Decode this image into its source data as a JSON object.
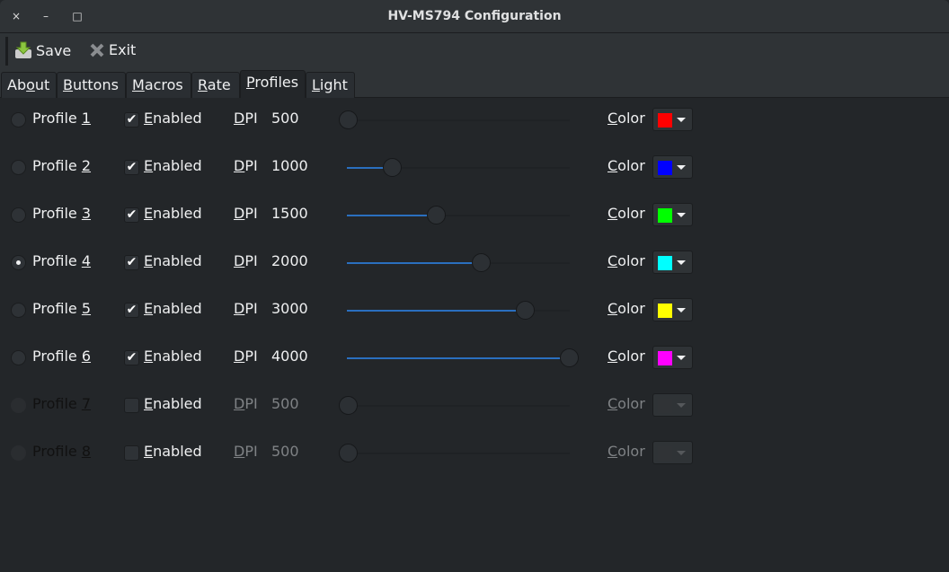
{
  "window": {
    "title": "HV-MS794 Configuration",
    "close": "×",
    "minimize": "–",
    "maximize": "□"
  },
  "toolbar": {
    "save": "Save",
    "exit": "Exit"
  },
  "tabs": [
    {
      "pre": "Ab",
      "u": "o",
      "post": "ut"
    },
    {
      "pre": "",
      "u": "B",
      "post": "uttons"
    },
    {
      "pre": "",
      "u": "M",
      "post": "acros"
    },
    {
      "pre": "",
      "u": "R",
      "post": "ate"
    },
    {
      "pre": "",
      "u": "P",
      "post": "rofiles"
    },
    {
      "pre": "",
      "u": "L",
      "post": "ight"
    }
  ],
  "active_tab": 4,
  "labels": {
    "profile": "Profile ",
    "enabled_u": "E",
    "enabled_rest": "nabled",
    "dpi_u": "D",
    "dpi_rest": "PI",
    "color_u": "C",
    "color_rest": "olor"
  },
  "profiles": [
    {
      "num": "1",
      "selected": false,
      "enabled": true,
      "dpi": "500",
      "slider": 0,
      "color": "#ff0000"
    },
    {
      "num": "2",
      "selected": false,
      "enabled": true,
      "dpi": "1000",
      "slider": 0.2,
      "color": "#0000ff"
    },
    {
      "num": "3",
      "selected": false,
      "enabled": true,
      "dpi": "1500",
      "slider": 0.4,
      "color": "#00ff00"
    },
    {
      "num": "4",
      "selected": true,
      "enabled": true,
      "dpi": "2000",
      "slider": 0.6,
      "color": "#00ffff"
    },
    {
      "num": "5",
      "selected": false,
      "enabled": true,
      "dpi": "3000",
      "slider": 0.8,
      "color": "#ffff00"
    },
    {
      "num": "6",
      "selected": false,
      "enabled": true,
      "dpi": "4000",
      "slider": 1,
      "color": "#ff00ff"
    },
    {
      "num": "7",
      "selected": false,
      "enabled": false,
      "dpi": "500",
      "slider": 0,
      "color": "#303336"
    },
    {
      "num": "8",
      "selected": false,
      "enabled": false,
      "dpi": "500",
      "slider": 0,
      "color": "#303336"
    }
  ]
}
